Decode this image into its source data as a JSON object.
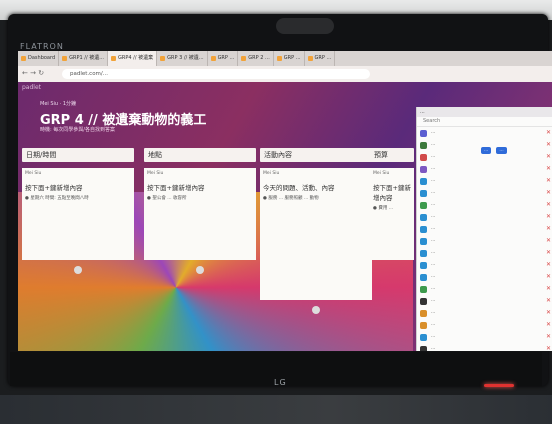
{
  "monitor": {
    "brand_left": "FLATRON",
    "logo": "LG"
  },
  "browser": {
    "tabs": [
      {
        "label": "Dashboard"
      },
      {
        "label": "GRP1 // 被遺..."
      },
      {
        "label": "GRP4 // 被遺棄"
      },
      {
        "label": "GRP 3 // 被遺..."
      },
      {
        "label": "GRP ..."
      },
      {
        "label": "GRP 2 ..."
      },
      {
        "label": "GRP ..."
      },
      {
        "label": "GRP ..."
      }
    ],
    "url": "padlet.com/..."
  },
  "padlet": {
    "logo": "padlet",
    "author": "Mei Siu · 1分鐘",
    "title": "GRP 4 // 被遺棄動物的義工",
    "subtitle": "時機: 每次同學參與/各自找到答案",
    "columns": [
      {
        "header": "日期/時間",
        "post_author": "Mei Siu",
        "post_title": "按下面+鍵新增內容",
        "post_text": "● 星期六 時間: 五點至晚間八時"
      },
      {
        "header": "地點",
        "post_author": "Mei Siu",
        "post_title": "按下面+鍵新增內容",
        "post_text": "● 聖公會 ... 收容所"
      },
      {
        "header": "活動內容",
        "post_author": "Mei Siu",
        "post_title": "今天的問題、活動、內容",
        "post_text": "● 服務 ... 服務照顧 ... 動物"
      },
      {
        "header": "預算",
        "post_author": "Mei Siu",
        "post_title": "按下面+鍵新增內容",
        "post_text": "● 費用 ..."
      }
    ]
  },
  "chat": {
    "header": "...",
    "search_placeholder": "Search",
    "buttons": [
      "...",
      "..."
    ],
    "rows": [
      {
        "name": "...",
        "color": "#5b5fd1"
      },
      {
        "name": "...",
        "color": "#3d7a3d"
      },
      {
        "name": "...",
        "color": "#d14a4a"
      },
      {
        "name": "...",
        "color": "#7d58c2"
      },
      {
        "name": "...",
        "color": "#2a8fd1"
      },
      {
        "name": "...",
        "color": "#2a8fd1"
      },
      {
        "name": "...",
        "color": "#3d9a4d"
      },
      {
        "name": "...",
        "color": "#2a8fd1"
      },
      {
        "name": "...",
        "color": "#2a8fd1"
      },
      {
        "name": "...",
        "color": "#2a8fd1"
      },
      {
        "name": "...",
        "color": "#2a8fd1"
      },
      {
        "name": "...",
        "color": "#2a8fd1"
      },
      {
        "name": "...",
        "color": "#2a8fd1"
      },
      {
        "name": "...",
        "color": "#3d9a4d"
      },
      {
        "name": "...",
        "color": "#333333"
      },
      {
        "name": "...",
        "color": "#d98f2a"
      },
      {
        "name": "...",
        "color": "#d98f2a"
      },
      {
        "name": "...",
        "color": "#2a8fd1"
      },
      {
        "name": "...",
        "color": "#333333"
      }
    ]
  }
}
